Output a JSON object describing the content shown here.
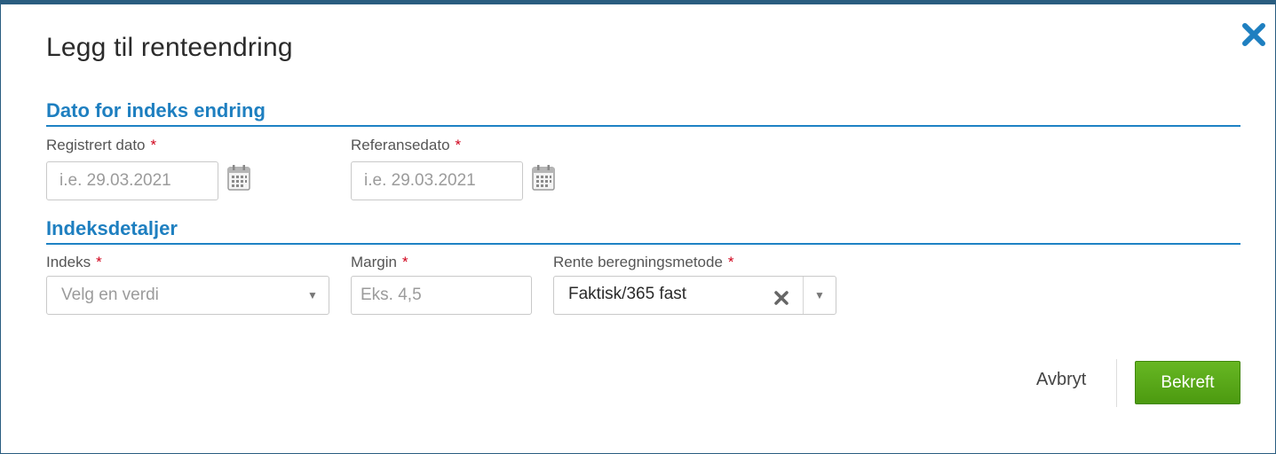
{
  "dialog": {
    "title": "Legg til renteendring",
    "close_icon": "close-icon"
  },
  "date_section": {
    "title": "Dato for indeks endring",
    "registered_date": {
      "label": "Registrert dato",
      "required_mark": "*",
      "placeholder": "i.e. 29.03.2021",
      "icon": "calendar-icon"
    },
    "reference_date": {
      "label": "Referansedato",
      "required_mark": "*",
      "placeholder": "i.e. 29.03.2021",
      "icon": "calendar-icon"
    }
  },
  "index_section": {
    "title": "Indeksdetaljer",
    "index": {
      "label": "Indeks",
      "required_mark": "*",
      "placeholder": "Velg en verdi",
      "icon": "chevron-down-icon"
    },
    "margin": {
      "label": "Margin",
      "required_mark": "*",
      "placeholder": "Eks. 4,5"
    },
    "method": {
      "label": "Rente beregningsmetode",
      "required_mark": "*",
      "value": "Faktisk/365 fast",
      "clear_icon": "clear-icon",
      "icon": "chevron-down-icon"
    }
  },
  "footer": {
    "cancel_label": "Avbryt",
    "confirm_label": "Bekreft",
    "confirm_color": "#5aa81a"
  },
  "colors": {
    "accent": "#1e7fc0",
    "frame": "#2a5d80",
    "required": "#d0021b"
  }
}
